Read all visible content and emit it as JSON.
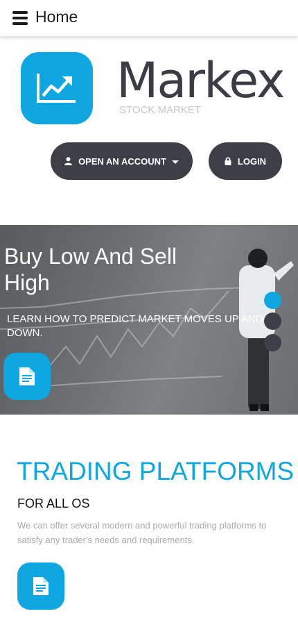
{
  "header": {
    "title": "Home",
    "menu_icon": "hamburger-icon"
  },
  "brand": {
    "name": "Markex",
    "tagline": "STOCK MARKET",
    "logo_icon": "chart-up-icon",
    "accent": "#0fa7e1"
  },
  "actions": {
    "open_account_label": "OPEN AN ACCOUNT",
    "open_account_icon": "user-icon",
    "login_label": "LOGIN",
    "login_icon": "lock-icon",
    "button_color": "#3c3f47"
  },
  "hero": {
    "title": "Buy Low And Sell High",
    "subtitle": "LEARN HOW TO PREDICT MARKET MOVES UP AND DOWN.",
    "slide_count": 3,
    "active_slide": 1
  },
  "feature": {
    "title": "TRADING PLATFORMS",
    "subtitle": "FOR ALL OS",
    "text": "We can offer several modern and powerful trading platforms to satisfy any trader's needs and requirements."
  }
}
